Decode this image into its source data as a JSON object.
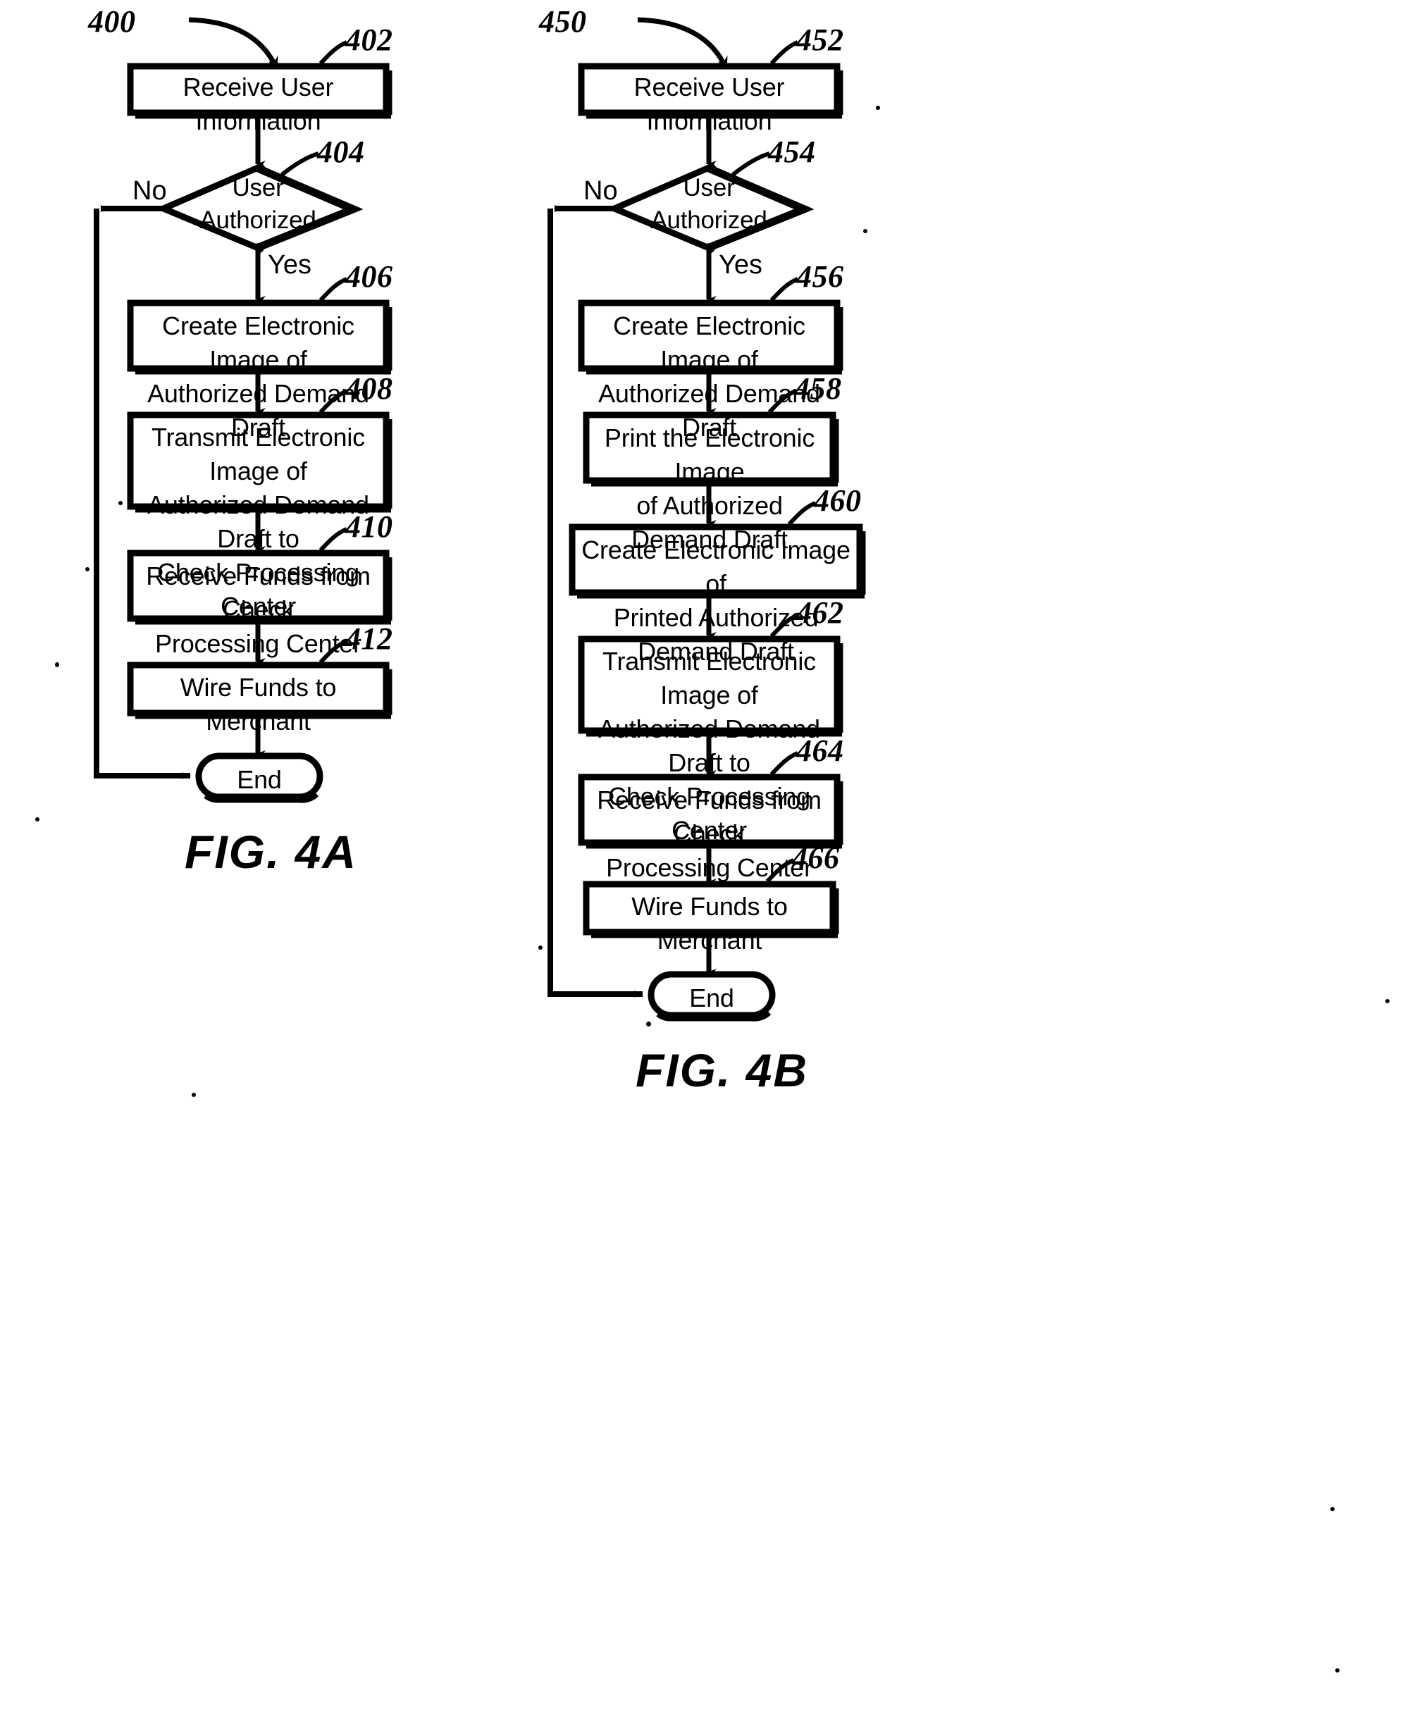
{
  "document": {
    "type": "patent-flowchart-drawing-sheet",
    "figures": [
      {
        "id": "fig-4a",
        "caption": "FIG. 4A",
        "flow_ref": "400",
        "nodes": [
          {
            "ref": "402",
            "shape": "process",
            "text": "Receive User Information"
          },
          {
            "ref": "404",
            "shape": "decision",
            "text": "User\nAuthorized\n?"
          },
          {
            "ref": "406",
            "shape": "process",
            "text": "Create Electronic Image of\nAuthorized Demand Draft"
          },
          {
            "ref": "408",
            "shape": "process",
            "text": "Transmit Electronic Image of\nAuthorized Demand Draft to\nCheck Processing Center"
          },
          {
            "ref": "410",
            "shape": "process",
            "text": "Receive Funds from Check\nProcessing Center"
          },
          {
            "ref": "412",
            "shape": "process",
            "text": "Wire Funds to Merchant"
          },
          {
            "ref": "",
            "shape": "terminator",
            "text": "End"
          }
        ],
        "edge_labels": {
          "no": "No",
          "yes": "Yes"
        }
      },
      {
        "id": "fig-4b",
        "caption": "FIG. 4B",
        "flow_ref": "450",
        "nodes": [
          {
            "ref": "452",
            "shape": "process",
            "text": "Receive User Information"
          },
          {
            "ref": "454",
            "shape": "decision",
            "text": "User\nAuthorized\n?"
          },
          {
            "ref": "456",
            "shape": "process",
            "text": "Create Electronic Image of\nAuthorized Demand Draft"
          },
          {
            "ref": "458",
            "shape": "process",
            "text": "Print the Electronic Image\nof Authorized Demand Draft"
          },
          {
            "ref": "460",
            "shape": "process",
            "text": "Create Electronic Image of\nPrinted Authorized Demand Draft"
          },
          {
            "ref": "462",
            "shape": "process",
            "text": "Transmit Electronic Image of\nAuthorized Demand Draft to\nCheck Processing Center"
          },
          {
            "ref": "464",
            "shape": "process",
            "text": "Receive Funds from Check\nProcessing Center"
          },
          {
            "ref": "466",
            "shape": "process",
            "text": "Wire Funds to Merchant"
          },
          {
            "ref": "",
            "shape": "terminator",
            "text": "End"
          }
        ],
        "edge_labels": {
          "no": "No",
          "yes": "Yes"
        }
      }
    ],
    "colors": {
      "ink": "#000000",
      "paper": "#ffffff"
    }
  }
}
